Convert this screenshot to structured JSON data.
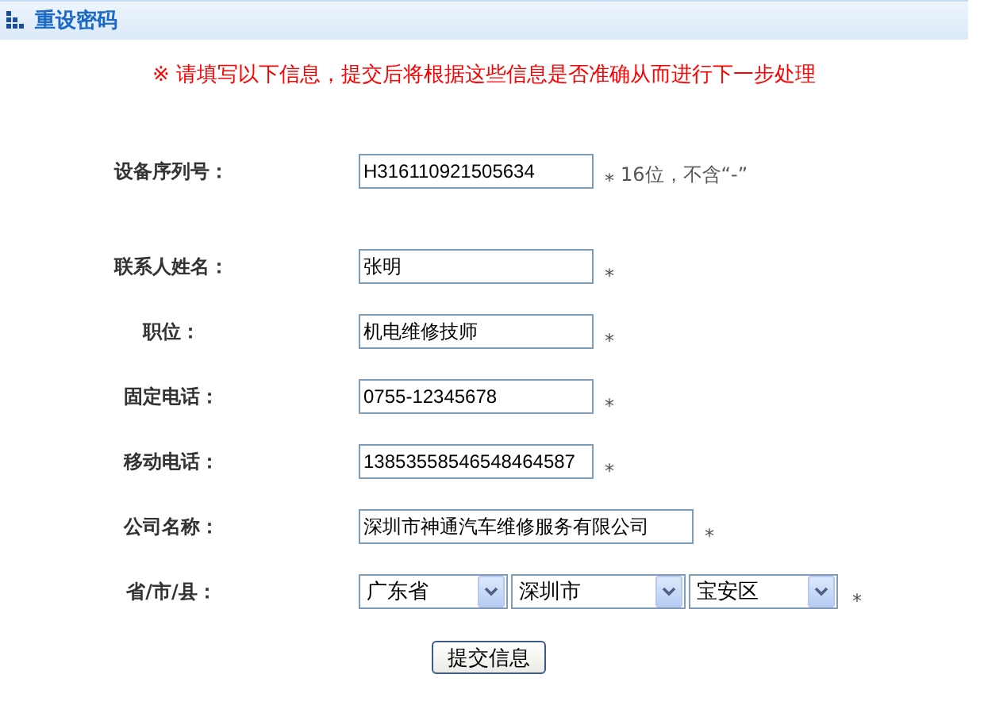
{
  "header": {
    "title": "重设密码"
  },
  "notice": "※ 请填写以下信息，提交后将根据这些信息是否准确从而进行下一步处理",
  "fields": [
    {
      "kind": "text",
      "label": "设备序列号：",
      "value": "H316110921505634",
      "required_mark": "*",
      "hint": "16位，不含“-”"
    },
    {
      "kind": "text",
      "label": "联系人姓名：",
      "value": "张明",
      "required_mark": "*"
    },
    {
      "kind": "text",
      "label": "职位：",
      "value": "机电维修技师",
      "required_mark": "*"
    },
    {
      "kind": "text",
      "label": "固定电话：",
      "value": "0755-12345678",
      "required_mark": "*"
    },
    {
      "kind": "text",
      "label": "移动电话：",
      "value": "13853558546548464587",
      "required_mark": "*"
    },
    {
      "kind": "long_text",
      "label": "公司名称：",
      "value": "深圳市神通汽车维修服务有限公司",
      "required_mark": "*"
    },
    {
      "kind": "select",
      "label": "省/市/县：",
      "selects": [
        {
          "value": "广东省"
        },
        {
          "value": "深圳市"
        },
        {
          "value": "宝安区"
        }
      ],
      "required_mark": "*"
    }
  ],
  "submit": "提交信息"
}
